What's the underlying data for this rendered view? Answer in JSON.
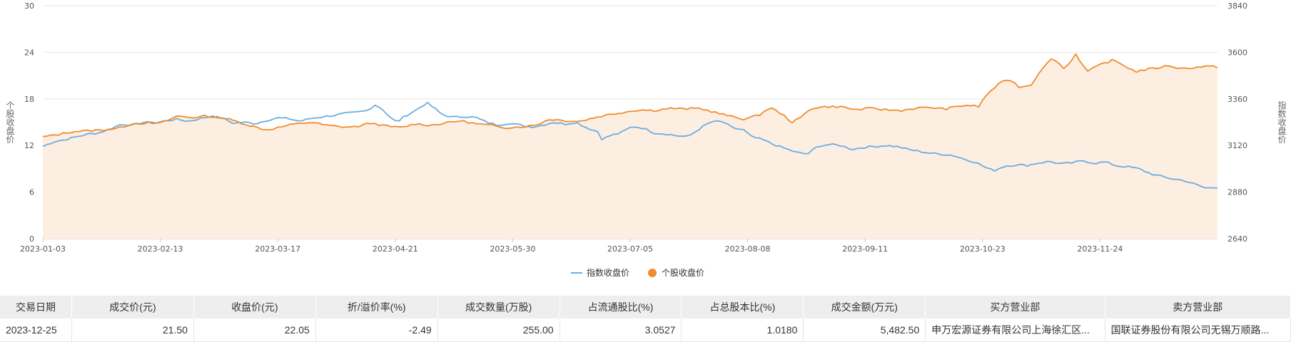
{
  "chart_data": {
    "type": "line",
    "ylabel_left": "个股收盘价",
    "ylabel_right": "指数收盘价",
    "ylim_left": [
      0,
      30
    ],
    "ylim_right": [
      2640,
      3840
    ],
    "yticks_left": [
      0,
      6,
      12,
      18,
      24,
      30
    ],
    "yticks_right": [
      2640,
      2880,
      3120,
      3360,
      3600,
      3840
    ],
    "x_tick_labels": [
      "2023-01-03",
      "2023-02-13",
      "2023-03-17",
      "2023-04-21",
      "2023-05-30",
      "2023-07-05",
      "2023-08-08",
      "2023-09-11",
      "2023-10-23",
      "2023-11-24"
    ],
    "x_tick_index": [
      0,
      29,
      58,
      87,
      116,
      145,
      174,
      203,
      232,
      261
    ],
    "x_count": 291,
    "grid": "horizontal",
    "legend_position": "bottom",
    "series": [
      {
        "name": "指数收盘价",
        "axis": "right",
        "color": "#6aaee0",
        "keypoints": [
          [
            0,
            3115
          ],
          [
            3,
            3140
          ],
          [
            6,
            3150
          ],
          [
            9,
            3165
          ],
          [
            12,
            3178
          ],
          [
            15,
            3185
          ],
          [
            18,
            3205
          ],
          [
            21,
            3230
          ],
          [
            24,
            3225
          ],
          [
            27,
            3240
          ],
          [
            30,
            3235
          ],
          [
            33,
            3248
          ],
          [
            36,
            3255
          ],
          [
            39,
            3245
          ],
          [
            42,
            3258
          ],
          [
            45,
            3270
          ],
          [
            48,
            3262
          ],
          [
            51,
            3235
          ],
          [
            54,
            3240
          ],
          [
            57,
            3232
          ],
          [
            60,
            3250
          ],
          [
            63,
            3262
          ],
          [
            66,
            3258
          ],
          [
            69,
            3245
          ],
          [
            72,
            3260
          ],
          [
            75,
            3268
          ],
          [
            78,
            3275
          ],
          [
            81,
            3285
          ],
          [
            84,
            3290
          ],
          [
            87,
            3300
          ],
          [
            89,
            3330
          ],
          [
            91,
            3310
          ],
          [
            93,
            3265
          ],
          [
            95,
            3240
          ],
          [
            97,
            3270
          ],
          [
            100,
            3302
          ],
          [
            103,
            3340
          ],
          [
            105,
            3312
          ],
          [
            107,
            3280
          ],
          [
            110,
            3265
          ],
          [
            113,
            3270
          ],
          [
            116,
            3265
          ],
          [
            119,
            3240
          ],
          [
            122,
            3225
          ],
          [
            125,
            3235
          ],
          [
            128,
            3225
          ],
          [
            131,
            3215
          ],
          [
            134,
            3225
          ],
          [
            137,
            3240
          ],
          [
            140,
            3230
          ],
          [
            143,
            3240
          ],
          [
            146,
            3210
          ],
          [
            149,
            3190
          ],
          [
            150,
            3150
          ],
          [
            152,
            3170
          ],
          [
            155,
            3185
          ],
          [
            158,
            3218
          ],
          [
            161,
            3210
          ],
          [
            164,
            3185
          ],
          [
            167,
            3180
          ],
          [
            170,
            3170
          ],
          [
            173,
            3165
          ],
          [
            176,
            3205
          ],
          [
            179,
            3240
          ],
          [
            182,
            3245
          ],
          [
            185,
            3210
          ],
          [
            188,
            3200
          ],
          [
            190,
            3165
          ],
          [
            193,
            3150
          ],
          [
            196,
            3125
          ],
          [
            199,
            3105
          ],
          [
            202,
            3085
          ],
          [
            205,
            3075
          ],
          [
            208,
            3118
          ],
          [
            211,
            3125
          ],
          [
            214,
            3120
          ],
          [
            217,
            3100
          ],
          [
            220,
            3110
          ],
          [
            223,
            3115
          ],
          [
            226,
            3120
          ],
          [
            229,
            3115
          ],
          [
            232,
            3100
          ],
          [
            235,
            3090
          ],
          [
            238,
            3080
          ],
          [
            241,
            3075
          ],
          [
            244,
            3070
          ],
          [
            247,
            3050
          ],
          [
            250,
            3035
          ],
          [
            253,
            3005
          ],
          [
            255,
            2990
          ],
          [
            258,
            3015
          ],
          [
            261,
            3020
          ],
          [
            264,
            3018
          ],
          [
            267,
            3030
          ],
          [
            270,
            3038
          ],
          [
            273,
            3025
          ],
          [
            276,
            3030
          ],
          [
            279,
            3042
          ],
          [
            282,
            3028
          ],
          [
            285,
            3035
          ],
          [
            288,
            3015
          ],
          [
            291,
            3010
          ],
          [
            294,
            3000
          ],
          [
            297,
            2975
          ],
          [
            300,
            2960
          ],
          [
            303,
            2948
          ],
          [
            306,
            2940
          ],
          [
            309,
            2920
          ],
          [
            312,
            2900
          ],
          [
            315,
            2905
          ]
        ]
      },
      {
        "name": "个股收盘价",
        "axis": "left",
        "color": "#f08c2e",
        "keypoints": [
          [
            0,
            13.1
          ],
          [
            4,
            13.4
          ],
          [
            8,
            13.8
          ],
          [
            12,
            13.9
          ],
          [
            16,
            14.0
          ],
          [
            20,
            14.2
          ],
          [
            24,
            14.8
          ],
          [
            28,
            14.9
          ],
          [
            32,
            14.9
          ],
          [
            36,
            15.8
          ],
          [
            40,
            15.6
          ],
          [
            44,
            15.8
          ],
          [
            48,
            15.6
          ],
          [
            52,
            15.1
          ],
          [
            56,
            14.5
          ],
          [
            60,
            14.0
          ],
          [
            64,
            14.4
          ],
          [
            68,
            14.8
          ],
          [
            72,
            15.0
          ],
          [
            76,
            14.6
          ],
          [
            80,
            14.4
          ],
          [
            84,
            14.4
          ],
          [
            88,
            14.9
          ],
          [
            92,
            14.5
          ],
          [
            96,
            14.3
          ],
          [
            100,
            14.8
          ],
          [
            104,
            14.6
          ],
          [
            108,
            14.9
          ],
          [
            112,
            15.2
          ],
          [
            116,
            14.8
          ],
          [
            120,
            14.6
          ],
          [
            124,
            14.3
          ],
          [
            128,
            14.4
          ],
          [
            132,
            14.6
          ],
          [
            136,
            15.4
          ],
          [
            140,
            15.2
          ],
          [
            144,
            15.1
          ],
          [
            148,
            15.6
          ],
          [
            152,
            16.0
          ],
          [
            156,
            16.3
          ],
          [
            160,
            16.6
          ],
          [
            164,
            16.5
          ],
          [
            168,
            16.8
          ],
          [
            172,
            16.7
          ],
          [
            176,
            16.8
          ],
          [
            180,
            16.3
          ],
          [
            184,
            15.8
          ],
          [
            188,
            15.4
          ],
          [
            192,
            15.9
          ],
          [
            195,
            16.9
          ],
          [
            198,
            16.1
          ],
          [
            201,
            15.0
          ],
          [
            203,
            15.5
          ],
          [
            206,
            16.8
          ],
          [
            210,
            17.0
          ],
          [
            214,
            17.0
          ],
          [
            218,
            16.6
          ],
          [
            222,
            16.8
          ],
          [
            226,
            16.6
          ],
          [
            230,
            16.5
          ],
          [
            234,
            16.8
          ],
          [
            238,
            16.9
          ],
          [
            242,
            16.7
          ],
          [
            245,
            17.0
          ],
          [
            248,
            17.2
          ],
          [
            251,
            17.0
          ],
          [
            253,
            18.5
          ],
          [
            256,
            19.8
          ],
          [
            259,
            20.6
          ],
          [
            262,
            19.5
          ],
          [
            265,
            19.8
          ],
          [
            268,
            22.0
          ],
          [
            271,
            23.3
          ],
          [
            274,
            21.8
          ],
          [
            277,
            23.8
          ],
          [
            280,
            21.5
          ],
          [
            284,
            22.5
          ],
          [
            287,
            23.0
          ],
          [
            290,
            22.3
          ],
          [
            293,
            21.5
          ],
          [
            296,
            21.8
          ],
          [
            299,
            22.0
          ],
          [
            302,
            22.3
          ],
          [
            305,
            21.9
          ],
          [
            308,
            22.0
          ],
          [
            312,
            22.2
          ],
          [
            315,
            22.1
          ]
        ]
      }
    ]
  },
  "table": {
    "headers": [
      "交易日期",
      "成交价(元)",
      "收盘价(元)",
      "折/溢价率(%)",
      "成交数量(万股)",
      "占流通股比(%)",
      "占总股本比(%)",
      "成交金额(万元)",
      "买方营业部",
      "卖方营业部"
    ],
    "rows": [
      [
        "2023-12-25",
        "21.50",
        "22.05",
        "-2.49",
        "255.00",
        "3.0527",
        "1.0180",
        "5,482.50",
        "申万宏源证券有限公司上海徐汇区...",
        "国联证券股份有限公司无锡万顺路..."
      ]
    ]
  }
}
